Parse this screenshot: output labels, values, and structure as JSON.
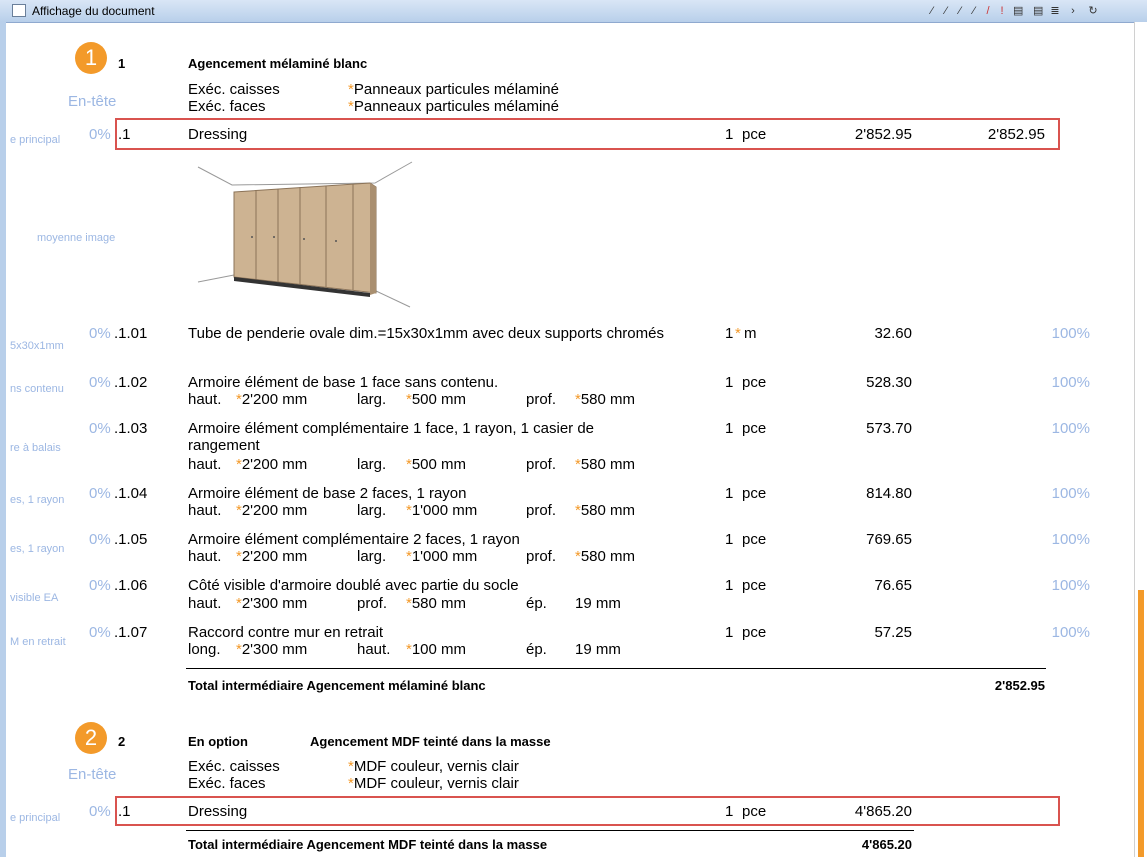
{
  "window": {
    "title": "Affichage du document"
  },
  "sections": [
    {
      "marker": "1",
      "number": "1",
      "title": "Agencement mélaminé blanc",
      "header_label": "En-tête",
      "caisses_label": "Exéc. caisses",
      "caisses_value": "Panneaux particules mélaminé",
      "faces_label": "Exéc. faces",
      "faces_value": "Panneaux particules mélaminé",
      "main": {
        "left": "e principal",
        "pct": "0%",
        "num": ".1",
        "desc": "Dressing",
        "qty": "1",
        "unit": "pce",
        "price": "2'852.95",
        "total": "2'852.95"
      },
      "image_label": "moyenne image",
      "items": [
        {
          "left": "5x30x1mm",
          "pct": "0%",
          "num": ".1.01",
          "desc": "Tube de penderie ovale dim.=15x30x1mm avec deux supports chromés",
          "qty": "1",
          "unit": "m",
          "price": "32.60",
          "rate": "100%"
        },
        {
          "left": "ns contenu",
          "pct": "0%",
          "num": ".1.02",
          "desc": "Armoire élément de base 1 face sans contenu.",
          "d1l": "haut.",
          "d1v": "2'200 mm",
          "d2l": "larg.",
          "d2v": "500 mm",
          "d3l": "prof.",
          "d3v": "580 mm",
          "qty": "1",
          "unit": "pce",
          "price": "528.30",
          "rate": "100%"
        },
        {
          "left": "re à balais",
          "pct": "0%",
          "num": ".1.03",
          "desc": "Armoire élément complémentaire 1 face, 1 rayon, 1 casier de",
          "desc2": "rangement",
          "d1l": "haut.",
          "d1v": "2'200 mm",
          "d2l": "larg.",
          "d2v": "500 mm",
          "d3l": "prof.",
          "d3v": "580 mm",
          "qty": "1",
          "unit": "pce",
          "price": "573.70",
          "rate": "100%"
        },
        {
          "left": "es, 1 rayon",
          "pct": "0%",
          "num": ".1.04",
          "desc": "Armoire élément de base 2 faces, 1 rayon",
          "d1l": "haut.",
          "d1v": "2'200 mm",
          "d2l": "larg.",
          "d2v": "1'000 mm",
          "d3l": "prof.",
          "d3v": "580 mm",
          "qty": "1",
          "unit": "pce",
          "price": "814.80",
          "rate": "100%"
        },
        {
          "left": "es, 1 rayon",
          "pct": "0%",
          "num": ".1.05",
          "desc": "Armoire élément complémentaire 2 faces, 1 rayon",
          "d1l": "haut.",
          "d1v": "2'200 mm",
          "d2l": "larg.",
          "d2v": "1'000 mm",
          "d3l": "prof.",
          "d3v": "580 mm",
          "qty": "1",
          "unit": "pce",
          "price": "769.65",
          "rate": "100%"
        },
        {
          "left": "visible EA",
          "pct": "0%",
          "num": ".1.06",
          "desc": "Côté visible d'armoire doublé avec partie du socle",
          "d1l": "haut.",
          "d1v": "2'300 mm",
          "d2l": "prof.",
          "d2v": "580 mm",
          "d3l": "ép.",
          "d3v": "19 mm",
          "qty": "1",
          "unit": "pce",
          "price": "76.65",
          "rate": "100%"
        },
        {
          "left": "M en retrait",
          "pct": "0%",
          "num": ".1.07",
          "desc": "Raccord contre mur en retrait",
          "d1l": "long.",
          "d1v": "2'300 mm",
          "d2l": "haut.",
          "d2v": "100 mm",
          "d3l": "ép.",
          "d3v": "19 mm",
          "qty": "1",
          "unit": "pce",
          "price": "57.25",
          "rate": "100%"
        }
      ],
      "subtotal_label": "Total intermédiaire Agencement mélaminé blanc",
      "subtotal_value": "2'852.95"
    },
    {
      "marker": "2",
      "number": "2",
      "option": "En option",
      "title": "Agencement MDF teinté dans la masse",
      "header_label": "En-tête",
      "caisses_label": "Exéc. caisses",
      "caisses_value": "MDF couleur, vernis clair",
      "faces_label": "Exéc. faces",
      "faces_value": "MDF couleur, vernis clair",
      "main": {
        "left": "e principal",
        "pct": "0%",
        "num": ".1",
        "desc": "Dressing",
        "qty": "1",
        "unit": "pce",
        "price": "4'865.20"
      },
      "subtotal_label": "Total intermédiaire Agencement MDF teinté dans la masse",
      "subtotal_value": "4'865.20"
    }
  ],
  "colors": {
    "accent": "#f39a2a",
    "highlight": "#d9534f",
    "muted": "#9cb7e3"
  }
}
